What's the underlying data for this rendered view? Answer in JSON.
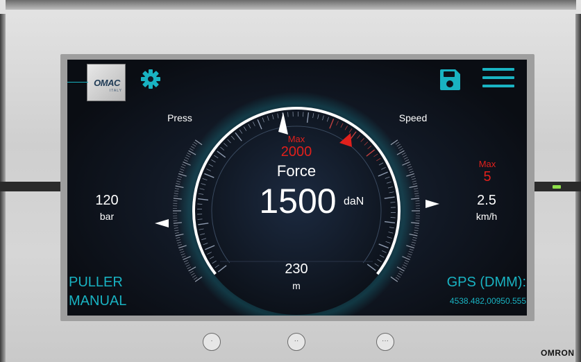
{
  "hmi": {
    "brand": "OMRON",
    "logo": {
      "name": "OMAC",
      "sub": "ITALY"
    },
    "toolbar": {
      "settings_icon": "gear-icon",
      "save_icon": "floppy-disk-icon",
      "menu_icon": "hamburger-menu-icon",
      "accent_color": "#19b3c2"
    },
    "force": {
      "label": "Force",
      "value": "1500",
      "unit": "daN",
      "max_label": "Max",
      "max_value": "2000"
    },
    "press": {
      "label": "Press",
      "value": "120",
      "unit": "bar"
    },
    "speed": {
      "label": "Speed",
      "value": "2.5",
      "unit": "km/h",
      "max_label": "Max",
      "max_value": "5"
    },
    "distance": {
      "value": "230",
      "unit": "m"
    },
    "mode": {
      "line1": "PULLER",
      "line2": "MANUAL"
    },
    "gps": {
      "label": "GPS (DMM):",
      "value": "4538.482,00950.555"
    },
    "hw_buttons": [
      "·",
      "··",
      "···"
    ]
  }
}
